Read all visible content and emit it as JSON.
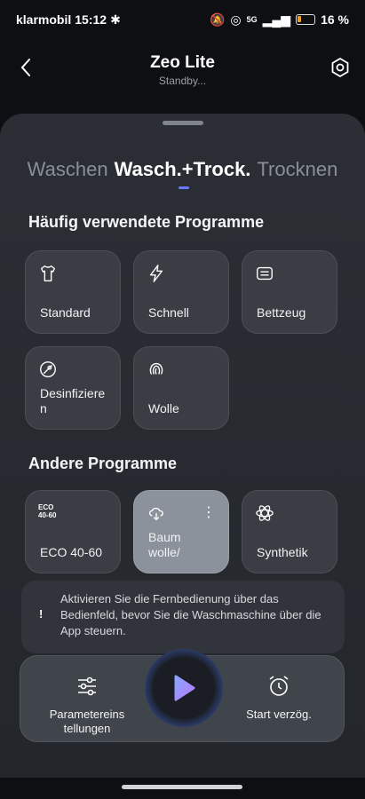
{
  "status": {
    "carrier": "klarmobil",
    "time": "15:12",
    "battery": "16 %",
    "network": "5G"
  },
  "header": {
    "title": "Zeo Lite",
    "subtitle": "Standby..."
  },
  "tabs": [
    "Waschen",
    "Wasch.+Trock.",
    "Trocknen"
  ],
  "sections": {
    "frequent_title": "Häufig verwendete Programme",
    "other_title": "Andere Programme"
  },
  "frequent": [
    {
      "label": "Standard",
      "icon": "shirt-icon"
    },
    {
      "label": "Schnell",
      "icon": "lightning-icon"
    },
    {
      "label": "Bettzeug",
      "icon": "bedding-icon"
    },
    {
      "label": "Desinfiziere\nn",
      "icon": "disinfect-icon"
    },
    {
      "label": "Wolle",
      "icon": "wool-icon"
    }
  ],
  "other": [
    {
      "label": "ECO 40-60",
      "icon": "eco-icon",
      "icon_text": "ECO\n40-60"
    },
    {
      "label": "Baum\nwolle/",
      "icon": "cotton-icon"
    },
    {
      "label": "Synthetik",
      "icon": "synthetic-icon"
    }
  ],
  "notice": {
    "bang": "!",
    "text": "Aktivieren Sie die Fernbedienung über das Bedienfeld, bevor Sie die Waschmaschine über die App steuern."
  },
  "bottom": {
    "params_label": "Parametereins tellungen",
    "delay_label": "Start verzög."
  }
}
